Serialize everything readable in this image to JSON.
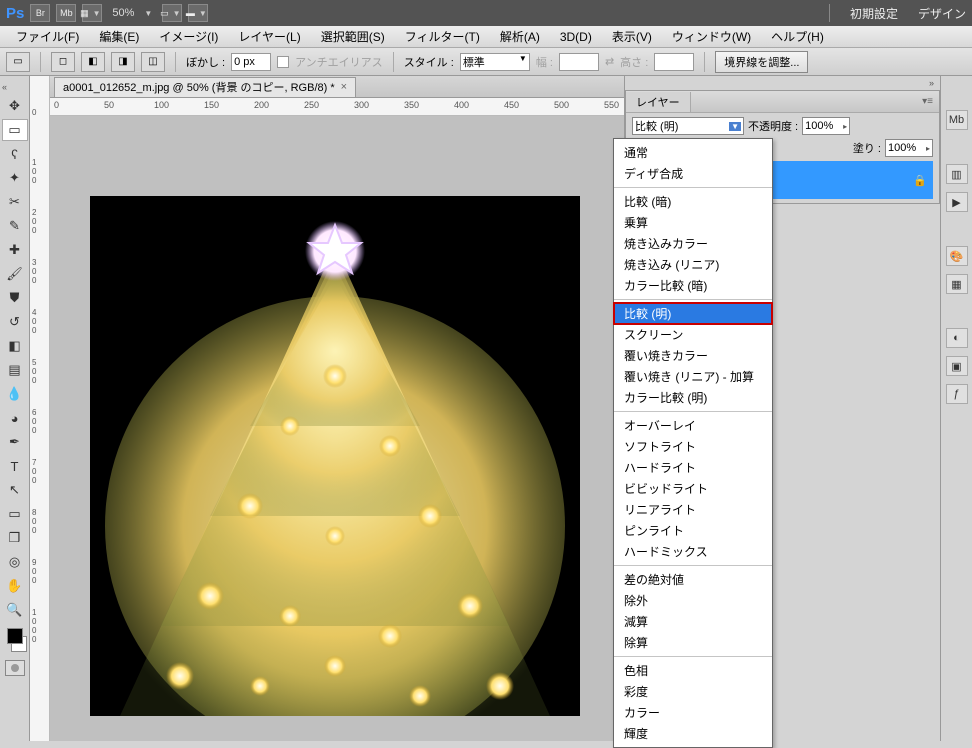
{
  "brandbar": {
    "ps": "Ps",
    "br": "Br",
    "mb": "Mb",
    "zoom": "50%",
    "right1": "初期設定",
    "right2": "デザイン"
  },
  "menubar": [
    "ファイル(F)",
    "編集(E)",
    "イメージ(I)",
    "レイヤー(L)",
    "選択範囲(S)",
    "フィルター(T)",
    "解析(A)",
    "3D(D)",
    "表示(V)",
    "ウィンドウ(W)",
    "ヘルプ(H)"
  ],
  "optbar": {
    "feather_label": "ぼかし :",
    "feather_value": "0 px",
    "antialias": "アンチエイリアス",
    "style_label": "スタイル :",
    "style_value": "標準",
    "width_label": "幅 :",
    "height_label": "高さ :",
    "refine": "境界線を調整..."
  },
  "doctab": {
    "title": "a0001_012652_m.jpg @ 50% (背景 のコピー, RGB/8) *"
  },
  "ruler_h": [
    "0",
    "50",
    "100",
    "150",
    "200",
    "250",
    "300",
    "350",
    "400",
    "450",
    "500",
    "550"
  ],
  "ruler_v": [
    "0",
    "100",
    "200",
    "300",
    "400",
    "500",
    "600",
    "700",
    "800",
    "900",
    "1000"
  ],
  "layers_panel": {
    "tab": "レイヤー",
    "blend_current": "比較 (明)",
    "opacity_label": "不透明度 :",
    "opacity_value": "100%",
    "fill_label": "塗り :",
    "fill_value": "100%"
  },
  "blend_dropdown": [
    {
      "items": [
        "通常",
        "ディザ合成"
      ]
    },
    {
      "items": [
        "比較 (暗)",
        "乗算",
        "焼き込みカラー",
        "焼き込み (リニア)",
        "カラー比較 (暗)"
      ]
    },
    {
      "items": [
        "比較 (明)",
        "スクリーン",
        "覆い焼きカラー",
        "覆い焼き (リニア) - 加算",
        "カラー比較 (明)"
      ],
      "selected": 0
    },
    {
      "items": [
        "オーバーレイ",
        "ソフトライト",
        "ハードライト",
        "ビビッドライト",
        "リニアライト",
        "ピンライト",
        "ハードミックス"
      ]
    },
    {
      "items": [
        "差の絶対値",
        "除外",
        "減算",
        "除算"
      ]
    },
    {
      "items": [
        "色相",
        "彩度",
        "カラー",
        "輝度"
      ]
    }
  ]
}
